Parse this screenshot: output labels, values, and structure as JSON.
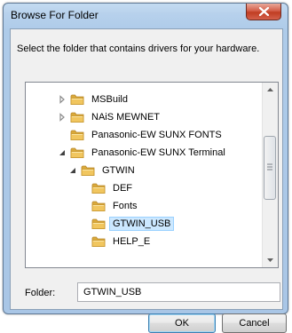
{
  "dialog": {
    "title": "Browse For Folder",
    "instruction": "Select the folder that contains drivers for your hardware."
  },
  "tree": {
    "items": [
      {
        "label": "MSBuild",
        "level": 0,
        "state": "collapsed",
        "selected": false
      },
      {
        "label": "NAiS MEWNET",
        "level": 0,
        "state": "collapsed",
        "selected": false
      },
      {
        "label": "Panasonic-EW SUNX FONTS",
        "level": 0,
        "state": "none",
        "selected": false
      },
      {
        "label": "Panasonic-EW SUNX Terminal",
        "level": 0,
        "state": "expanded",
        "selected": false
      },
      {
        "label": "GTWIN",
        "level": 1,
        "state": "expanded",
        "selected": false
      },
      {
        "label": "DEF",
        "level": 2,
        "state": "none",
        "selected": false
      },
      {
        "label": "Fonts",
        "level": 2,
        "state": "none",
        "selected": false
      },
      {
        "label": "GTWIN_USB",
        "level": 2,
        "state": "none",
        "selected": true
      },
      {
        "label": "HELP_E",
        "level": 2,
        "state": "none",
        "selected": false
      }
    ]
  },
  "folder_field": {
    "label": "Folder:",
    "value": "GTWIN_USB"
  },
  "buttons": {
    "ok": "OK",
    "cancel": "Cancel"
  },
  "icons": {
    "close": "close-icon",
    "folder": "folder-icon",
    "expand": "expand-arrow-icon",
    "collapse": "collapse-arrow-icon"
  },
  "colors": {
    "frame": "#aecbe9",
    "close_button": "#c8432a",
    "selection": "#cce8ff",
    "folder": "#f1c65f"
  }
}
